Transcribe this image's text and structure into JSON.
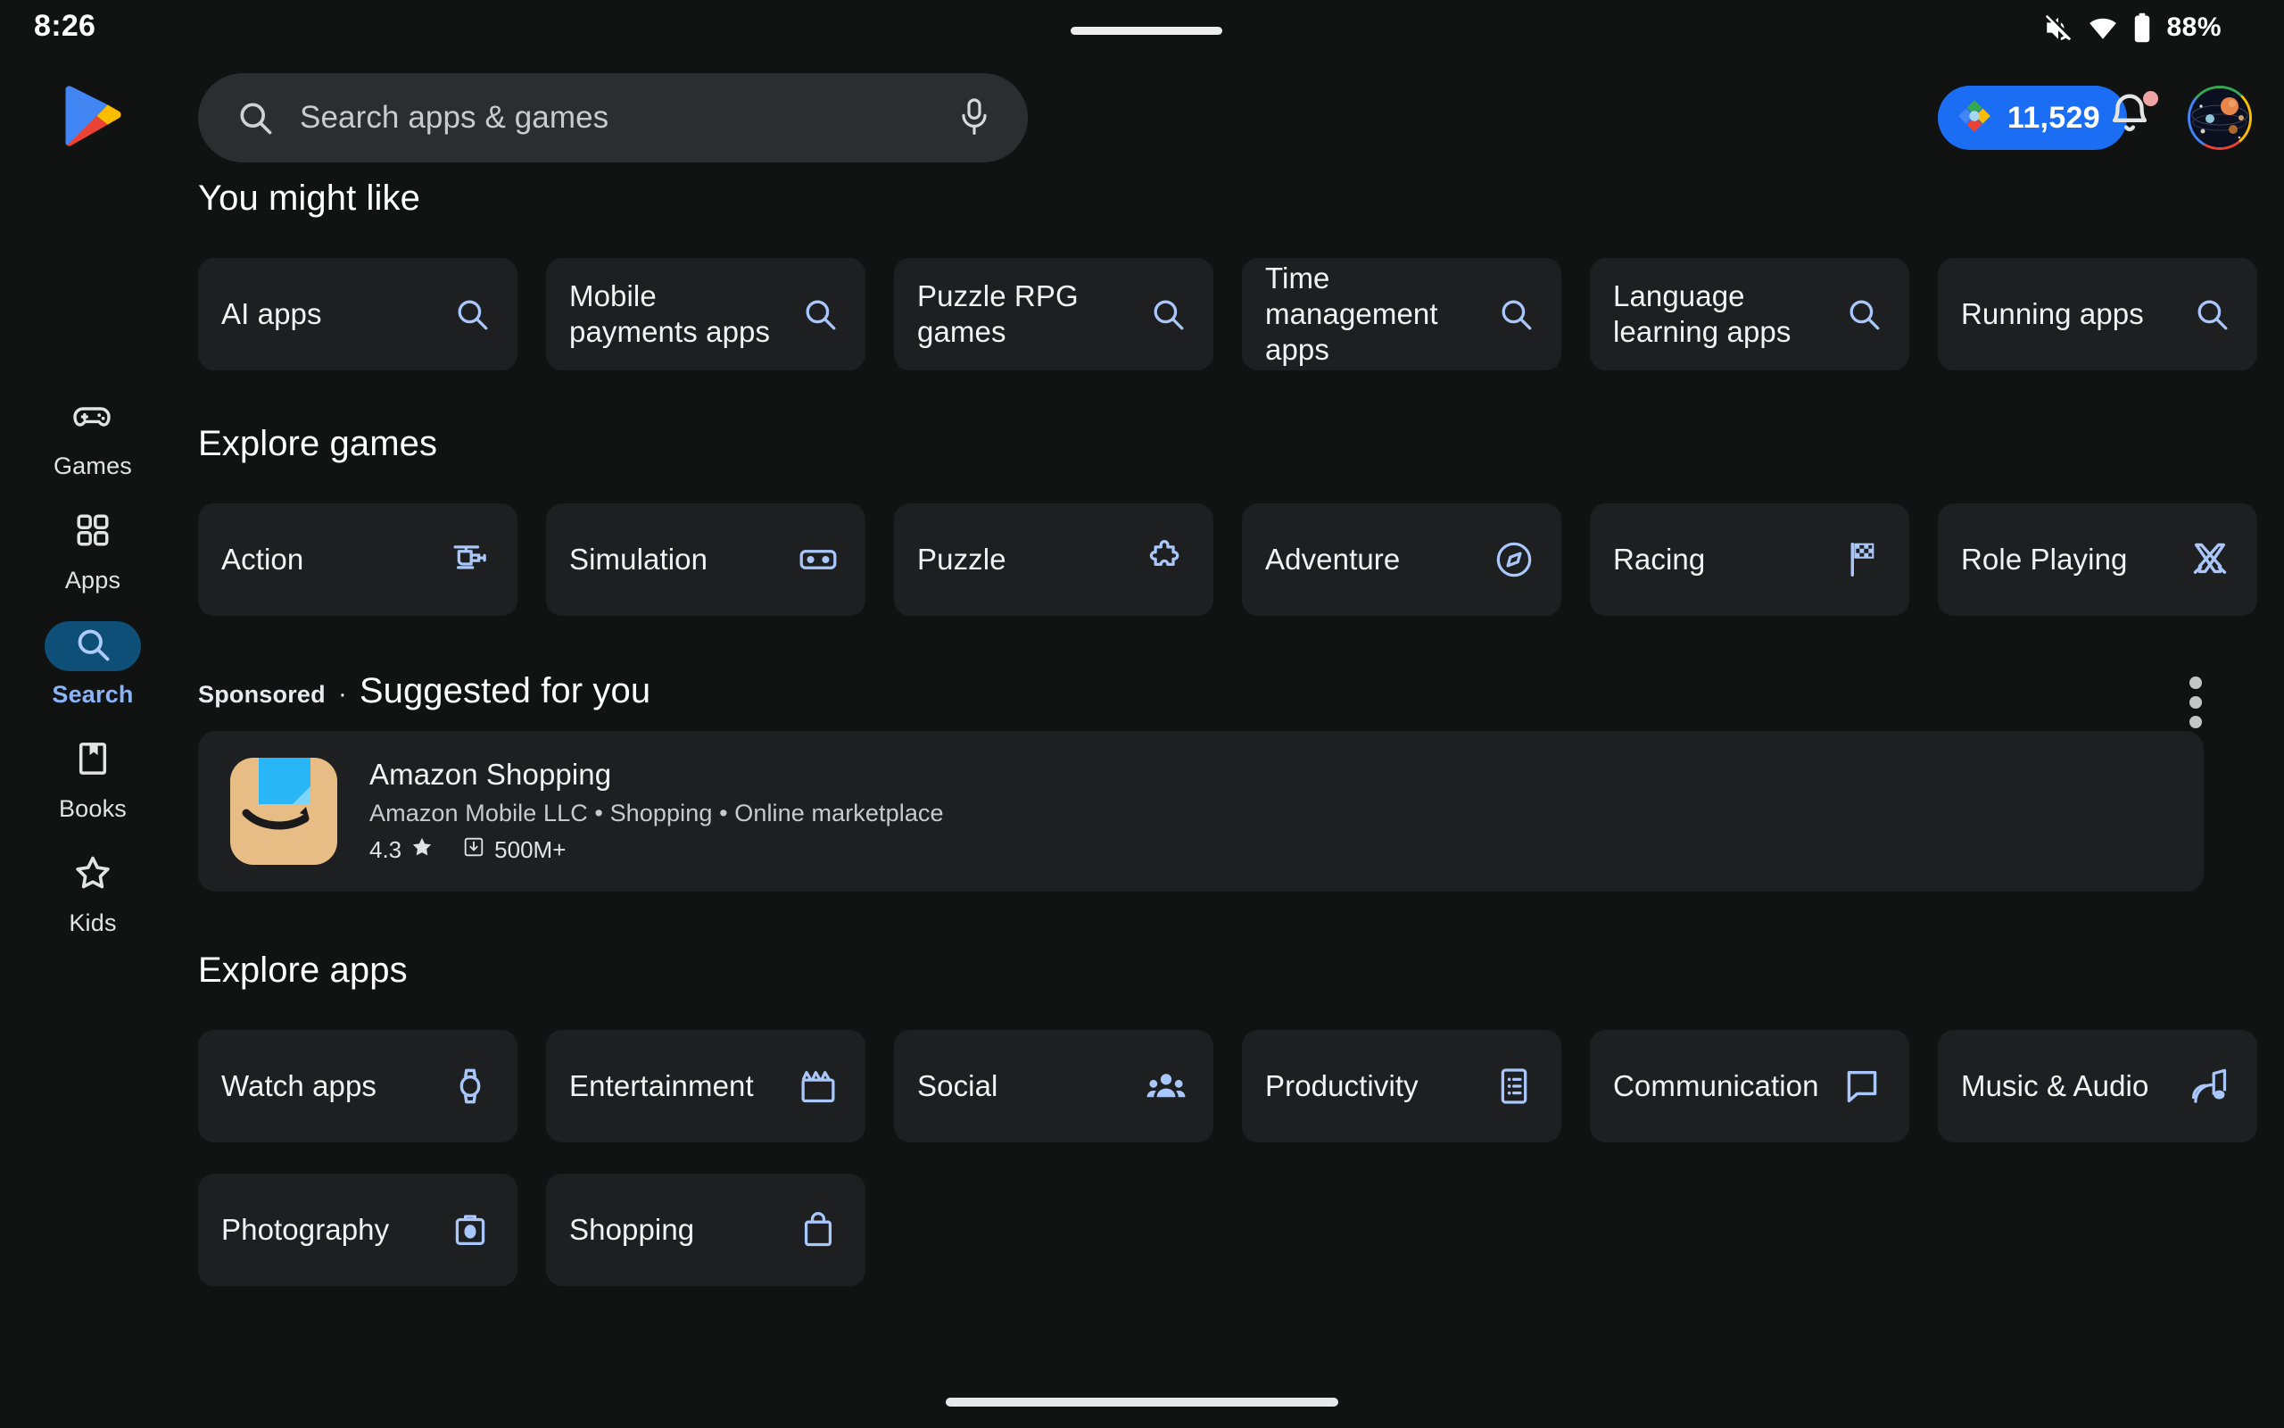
{
  "status_bar": {
    "clock": "8:26",
    "battery_percent": "88%",
    "icons": [
      "mute-icon",
      "wifi-icon",
      "battery-icon"
    ]
  },
  "header": {
    "logo": "google-play-logo",
    "search": {
      "placeholder": "Search apps & games",
      "value": "",
      "leading_icon": "search-icon",
      "trailing_icon": "microphone-icon"
    },
    "play_points": {
      "value": "11,529",
      "icon": "play-points-icon"
    },
    "notifications": {
      "icon": "bell-icon",
      "has_badge": true
    },
    "avatar": {
      "icon": "user-avatar",
      "ring": "google-colors"
    }
  },
  "sidebar": {
    "items": [
      {
        "label": "Games",
        "icon": "gamepad-icon",
        "active": false
      },
      {
        "label": "Apps",
        "icon": "apps-grid-icon",
        "active": false
      },
      {
        "label": "Search",
        "icon": "search-icon",
        "active": true
      },
      {
        "label": "Books",
        "icon": "book-bookmark-icon",
        "active": false
      },
      {
        "label": "Kids",
        "icon": "star-icon",
        "active": false
      }
    ]
  },
  "sections": {
    "you_might_like": {
      "title": "You might like",
      "chips": [
        {
          "label": "AI apps",
          "icon": "search-icon"
        },
        {
          "label": "Mobile payments apps",
          "icon": "search-icon"
        },
        {
          "label": "Puzzle RPG games",
          "icon": "search-icon"
        },
        {
          "label": "Time management apps",
          "icon": "search-icon"
        },
        {
          "label": "Language learning apps",
          "icon": "search-icon"
        },
        {
          "label": "Running apps",
          "icon": "search-icon"
        }
      ]
    },
    "explore_games": {
      "title": "Explore games",
      "categories": [
        {
          "label": "Action",
          "icon": "helicopter-icon"
        },
        {
          "label": "Simulation",
          "icon": "vr-goggles-icon"
        },
        {
          "label": "Puzzle",
          "icon": "puzzle-piece-icon"
        },
        {
          "label": "Adventure",
          "icon": "compass-icon"
        },
        {
          "label": "Racing",
          "icon": "checkered-flag-icon"
        },
        {
          "label": "Role Playing",
          "icon": "crossed-swords-icon"
        }
      ]
    },
    "suggested": {
      "sponsored_label": "Sponsored",
      "separator": "·",
      "title": "Suggested for you",
      "menu_icon": "more-vertical-icon",
      "app": {
        "icon": "amazon-shopping-icon",
        "name": "Amazon Shopping",
        "subtitle": "Amazon Mobile LLC • Shopping • Online marketplace",
        "rating": "4.3",
        "rating_icon": "star-icon",
        "downloads": "500M+",
        "downloads_icon": "download-icon"
      }
    },
    "explore_apps": {
      "title": "Explore apps",
      "categories": [
        {
          "label": "Watch apps",
          "icon": "smartwatch-icon"
        },
        {
          "label": "Entertainment",
          "icon": "clapperboard-icon"
        },
        {
          "label": "Social",
          "icon": "people-group-icon"
        },
        {
          "label": "Productivity",
          "icon": "checklist-icon"
        },
        {
          "label": "Communication",
          "icon": "chat-bubble-icon"
        },
        {
          "label": "Music & Audio",
          "icon": "music-note-icon"
        },
        {
          "label": "Photography",
          "icon": "camera-icon"
        },
        {
          "label": "Shopping",
          "icon": "shopping-bag-icon"
        }
      ]
    }
  },
  "colors": {
    "page_background": "#111212",
    "card_background": "#1e1f21",
    "search_background": "#2c2d2f",
    "accent_blue": "#1b6ef3",
    "icon_blue": "#a9c7fb",
    "active_pill": "#0d4f76",
    "active_label": "#8ab4f8"
  }
}
